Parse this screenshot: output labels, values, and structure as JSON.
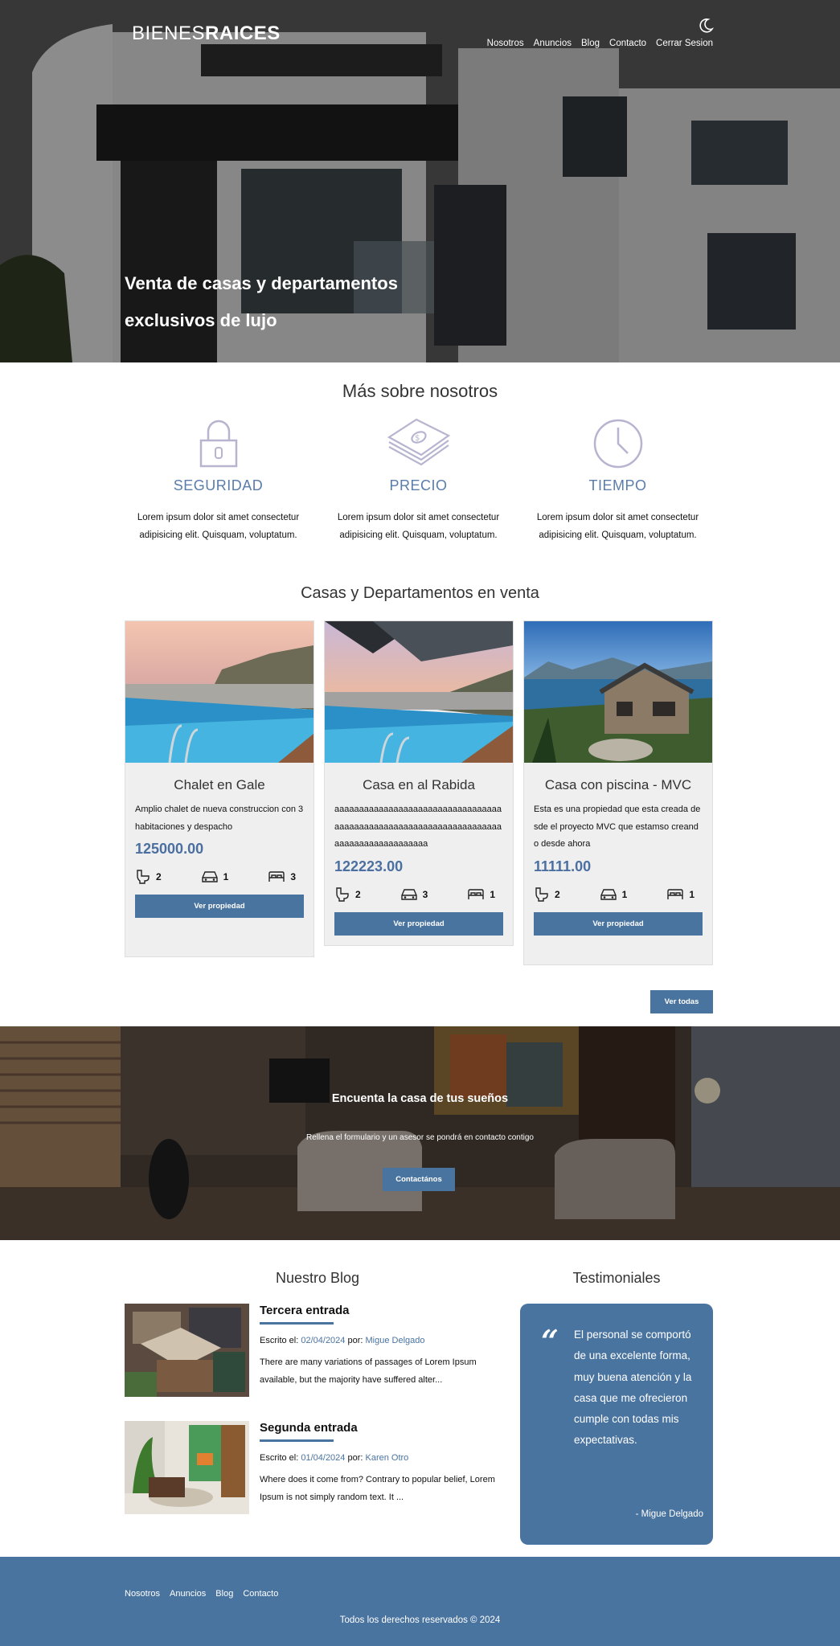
{
  "header": {
    "logo_light": "BIENES",
    "logo_bold": "RAICES",
    "theme_toggle_icon": "moon-icon",
    "nav": [
      "Nosotros",
      "Anuncios",
      "Blog",
      "Contacto",
      "Cerrar Sesion"
    ],
    "hero_title": "Venta de casas y departamentos exclusivos de lujo"
  },
  "about": {
    "title": "Más sobre nosotros",
    "features": [
      {
        "icon": "lock-icon",
        "title": "SEGURIDAD",
        "text": "Lorem ipsum dolor sit amet consectetur adipisicing elit. Quisquam, voluptatum."
      },
      {
        "icon": "money-icon",
        "title": "PRECIO",
        "text": "Lorem ipsum dolor sit amet consectetur adipisicing elit. Quisquam, voluptatum."
      },
      {
        "icon": "clock-icon",
        "title": "TIEMPO",
        "text": "Lorem ipsum dolor sit amet consectetur adipisicing elit. Quisquam, voluptatum."
      }
    ]
  },
  "listings": {
    "title": "Casas y Departamentos en venta",
    "cards": [
      {
        "title": "Chalet en Gale",
        "description": "Amplio chalet de nueva construccion con 3 habitaciones y despacho",
        "price": "125000.00",
        "wc": "2",
        "parking": "1",
        "rooms": "3",
        "button": "Ver propiedad"
      },
      {
        "title": "Casa en al Rabida",
        "description": "aaaaaaaaaaaaaaaaaaaaaaaaaaaaaaaaaaaaaaaaaaaaaaaaaaaaaaaaaaaaaaaaaaaaaaaaaaaaaaaaaaaaaaa",
        "price": "122223.00",
        "wc": "2",
        "parking": "3",
        "rooms": "1",
        "button": "Ver propiedad"
      },
      {
        "title": "Casa con piscina - MVC",
        "description": "Esta es una propiedad que esta creada desde el proyecto MVC que estamso creando desde ahora",
        "price": "11111.00",
        "wc": "2",
        "parking": "1",
        "rooms": "1",
        "button": "Ver propiedad"
      }
    ],
    "see_all": "Ver todas"
  },
  "contact_banner": {
    "title": "Encuenta la casa de tus sueños",
    "text": "Rellena el formulario y un asesor se pondrá en contacto contigo",
    "button": "Contactános"
  },
  "blog": {
    "title": "Nuestro Blog",
    "entries": [
      {
        "title": "Tercera entrada",
        "meta_prefix": "Escrito el: ",
        "date": "02/04/2024",
        "meta_by": " por: ",
        "author": "Migue Delgado",
        "excerpt": "There are many variations of passages of Lorem Ipsum available, but the majority have suffered alter..."
      },
      {
        "title": "Segunda entrada",
        "meta_prefix": "Escrito el: ",
        "date": "01/04/2024",
        "meta_by": " por: ",
        "author": "Karen Otro",
        "excerpt": "Where does it come from? Contrary to popular belief, Lorem Ipsum is not simply random text. It ..."
      }
    ]
  },
  "testimonials": {
    "title": "Testimoniales",
    "quote": "El personal se comportó de una excelente forma, muy buena atención y la casa que me ofrecieron cumple con todas mis expectativas.",
    "author": "- Migue Delgado"
  },
  "footer": {
    "nav": [
      "Nosotros",
      "Anuncios",
      "Blog",
      "Contacto"
    ],
    "copyright": "Todos los derechos reservados © 2024"
  },
  "colors": {
    "primary": "#4a74a0",
    "feature_title": "#5a7dab",
    "card_bg": "#efefef"
  }
}
